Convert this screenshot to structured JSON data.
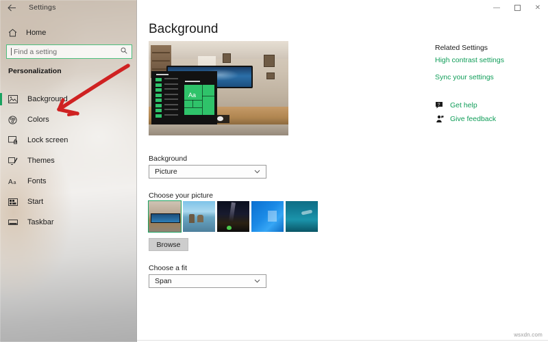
{
  "titlebar": {
    "back_icon": "back-arrow-icon",
    "title": "Settings",
    "minimize": "—",
    "maximize": "❐",
    "close": "✕"
  },
  "sidebar": {
    "home": {
      "label": "Home",
      "icon": "home-icon"
    },
    "search": {
      "placeholder": "Find a setting",
      "value": "",
      "icon": "search-icon"
    },
    "section": "Personalization",
    "items": [
      {
        "label": "Background",
        "icon": "picture-icon",
        "selected": true
      },
      {
        "label": "Colors",
        "icon": "color-wheel-icon",
        "selected": false
      },
      {
        "label": "Lock screen",
        "icon": "lock-screen-icon",
        "selected": false
      },
      {
        "label": "Themes",
        "icon": "themes-icon",
        "selected": false
      },
      {
        "label": "Fonts",
        "icon": "fonts-icon",
        "selected": false
      },
      {
        "label": "Start",
        "icon": "start-tiles-icon",
        "selected": false
      },
      {
        "label": "Taskbar",
        "icon": "taskbar-icon",
        "selected": false
      }
    ]
  },
  "main": {
    "page_title": "Background",
    "preview": {
      "name": "desktop-preview",
      "sample_text": "Aa"
    },
    "background": {
      "label": "Background",
      "value": "Picture",
      "chevron": "⌄"
    },
    "choose_picture": {
      "label": "Choose your picture",
      "thumbnails": [
        {
          "name": "thumbnail-desk-setup",
          "selected": true
        },
        {
          "name": "thumbnail-beach",
          "selected": false
        },
        {
          "name": "thumbnail-night-sky",
          "selected": false
        },
        {
          "name": "thumbnail-windows-blue",
          "selected": false
        },
        {
          "name": "thumbnail-underwater",
          "selected": false
        }
      ],
      "browse_label": "Browse"
    },
    "choose_fit": {
      "label": "Choose a fit",
      "value": "Span",
      "chevron": "⌄"
    }
  },
  "related": {
    "heading": "Related Settings",
    "links": [
      {
        "label": "High contrast settings"
      },
      {
        "label": "Sync your settings"
      }
    ],
    "support": [
      {
        "label": "Get help",
        "icon": "help-bubble-icon"
      },
      {
        "label": "Give feedback",
        "icon": "feedback-person-icon"
      }
    ]
  },
  "annotation": {
    "name": "red-arrow-annotation",
    "color": "#cf2222",
    "points_to": "Colors"
  },
  "watermark": {
    "text": "wsxdn.com"
  },
  "colors": {
    "accent_green": "#1aa260",
    "link_green": "#0f9d58",
    "annotation_red": "#cf2222",
    "page_bg": "#ffffff"
  }
}
